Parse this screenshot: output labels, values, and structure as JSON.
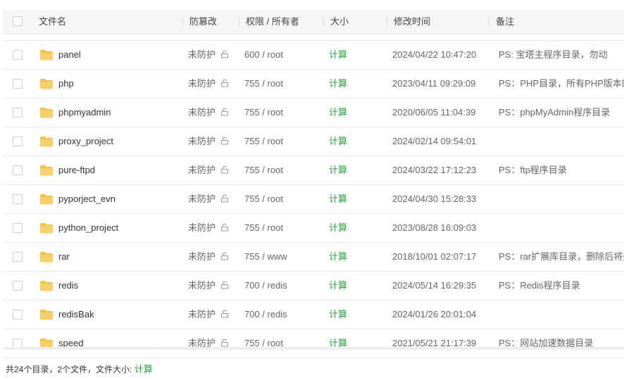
{
  "header": {
    "filename": "文件名",
    "protection": "防篡改",
    "permission": "权限 / 所有者",
    "size": "大小",
    "mtime": "修改时间",
    "note": "备注"
  },
  "rows": [
    {
      "name": "panel",
      "protection": "未防护",
      "permission": "600 / root",
      "size": "计算",
      "mtime": "2024/04/22 10:47:20",
      "note": "PS: 宝塔主程序目录，勿动"
    },
    {
      "name": "php",
      "protection": "未防护",
      "permission": "755 / root",
      "size": "计算",
      "mtime": "2023/04/11 09:29:09",
      "note": "PS：PHP目录，所有PHP版本的解"
    },
    {
      "name": "phpmyadmin",
      "protection": "未防护",
      "permission": "755 / root",
      "size": "计算",
      "mtime": "2020/06/05 11:04:39",
      "note": "PS：phpMyAdmin程序目录"
    },
    {
      "name": "proxy_project",
      "protection": "未防护",
      "permission": "755 / root",
      "size": "计算",
      "mtime": "2024/02/14 09:54:01",
      "note": ""
    },
    {
      "name": "pure-ftpd",
      "protection": "未防护",
      "permission": "755 / root",
      "size": "计算",
      "mtime": "2024/03/22 17:12:23",
      "note": "PS：ftp程序目录"
    },
    {
      "name": "pyporject_evn",
      "protection": "未防护",
      "permission": "755 / root",
      "size": "计算",
      "mtime": "2024/04/30 15:28:33",
      "note": ""
    },
    {
      "name": "python_project",
      "protection": "未防护",
      "permission": "755 / root",
      "size": "计算",
      "mtime": "2023/08/28 16:09:03",
      "note": ""
    },
    {
      "name": "rar",
      "protection": "未防护",
      "permission": "755 / www",
      "size": "计算",
      "mtime": "2018/10/01 02:07:17",
      "note": "PS：rar扩展库目录，删除后将失去"
    },
    {
      "name": "redis",
      "protection": "未防护",
      "permission": "700 / redis",
      "size": "计算",
      "mtime": "2024/05/14 16:29:35",
      "note": "PS：Redis程序目录"
    },
    {
      "name": "redisBak",
      "protection": "未防护",
      "permission": "700 / redis",
      "size": "计算",
      "mtime": "2024/01/26 20:01:04",
      "note": ""
    },
    {
      "name": "speed",
      "protection": "未防护",
      "permission": "755 / root",
      "size": "计算",
      "mtime": "2021/05/21 21:17:39",
      "note": "PS：网站加速数据目录"
    }
  ],
  "footer": {
    "summary": "共24个目录，2个文件，文件大小:",
    "calc": "计算"
  },
  "colors": {
    "accent_green": "#20a53a",
    "folder_yellow": "#f6c445"
  },
  "icons": {
    "folder": "folder-icon",
    "lock": "unlock-icon"
  }
}
